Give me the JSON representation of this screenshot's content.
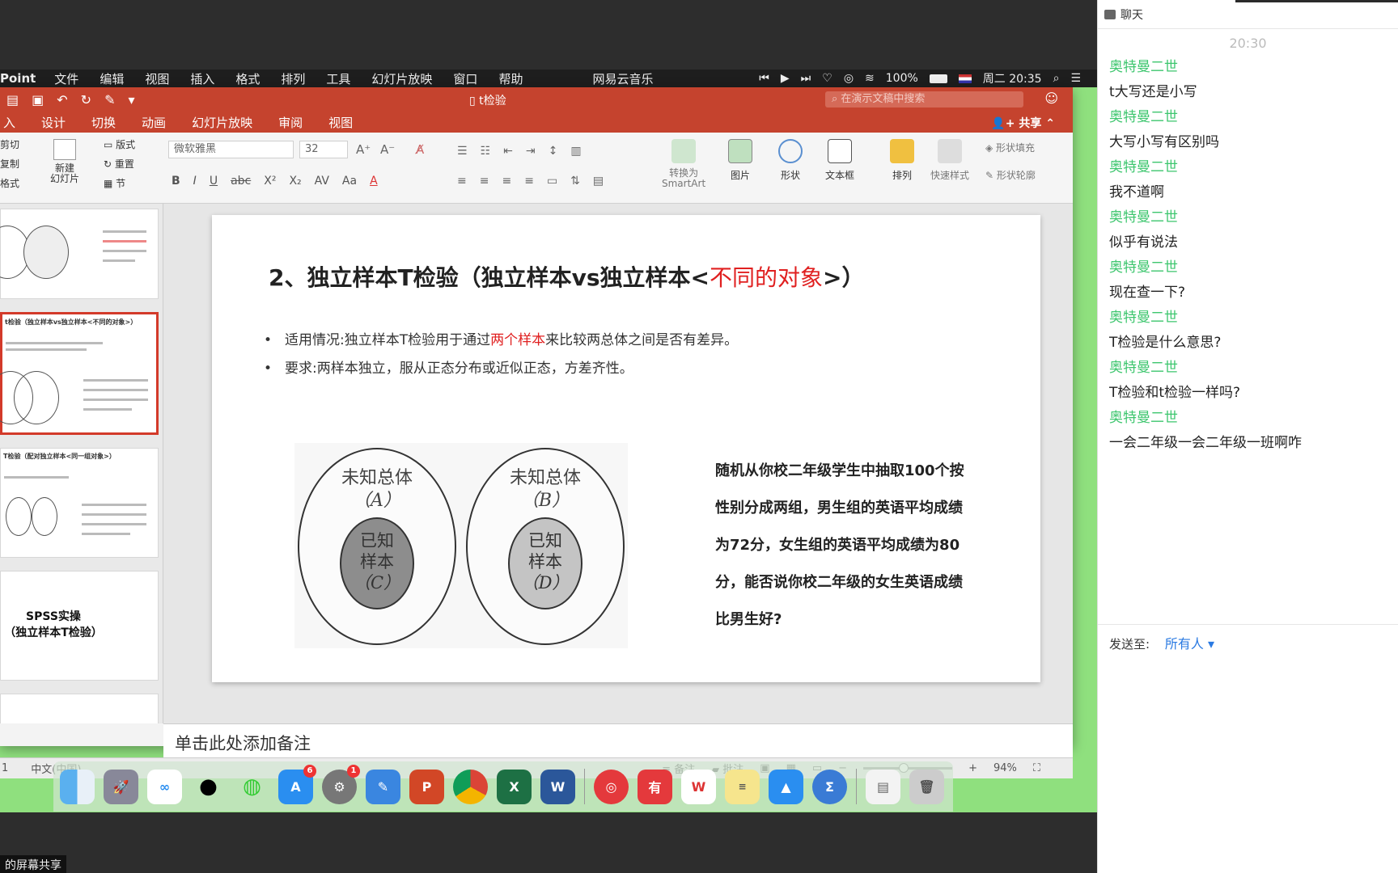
{
  "mac_menubar": {
    "app_name": "Point",
    "menus": [
      "文件",
      "编辑",
      "视图",
      "插入",
      "格式",
      "排列",
      "工具",
      "幻灯片放映",
      "窗口",
      "帮助"
    ],
    "netease": "网易云音乐",
    "battery": "100%",
    "clock": "周二 20:35"
  },
  "titlebar": {
    "doc_title": "t检验",
    "search_placeholder": "在演示文稿中搜索"
  },
  "ribbon_tabs": {
    "tabs": [
      "入",
      "设计",
      "切换",
      "动画",
      "幻灯片放映",
      "审阅",
      "视图"
    ],
    "share": "共享"
  },
  "ribbon": {
    "cut": "剪切",
    "copy": "复制",
    "format": "格式",
    "new_slide": "新建\n幻灯片",
    "layout": "版式",
    "reset": "重置",
    "section": "节",
    "font": "微软雅黑",
    "size": "32",
    "convert": "转换为\nSmartArt",
    "picture": "图片",
    "shape": "形状",
    "textbox": "文本框",
    "arrange": "排列",
    "quick_style": "快速样式",
    "shape_fill": "形状填充",
    "shape_outline": "形状轮廓"
  },
  "thumbnails": {
    "t2_title": "t检验（独立样本vs独立样本<不同的对象>）",
    "t3_title": "T检验（配对独立样本<同一组对象>）",
    "t4_line1": "SPSS实操",
    "t4_line2": "（独立样本T检验）"
  },
  "slide": {
    "title_main": "2、独立样本T检验（独立样本vs独立样本<",
    "title_red": "不同的对象",
    "title_end": ">）",
    "bullet1_pre": "适用情况:独立样本T检验用于通过",
    "bullet1_red": "两个样本",
    "bullet1_post": "来比较两总体之间是否有差异。",
    "bullet2": "要求:两样本独立，服从正态分布或近似正态，方差齐性。",
    "venn_a_top1": "未知总体",
    "venn_a_top2": "（A）",
    "venn_a_in1": "已知",
    "venn_a_in2": "样本",
    "venn_a_in3": "（C）",
    "venn_b_top1": "未知总体",
    "venn_b_top2": "（B）",
    "venn_b_in1": "已知",
    "venn_b_in2": "样本",
    "venn_b_in3": "（D）",
    "example": "随机从你校二年级学生中抽取100个按性别分成两组，男生组的英语平均成绩为72分，女生组的英语平均成绩为80分，能否说你校二年级的女生英语成绩比男生好?"
  },
  "notes": "单击此处添加备注",
  "status": {
    "slide_num": "1",
    "lang": "中文(中国)",
    "notes_btn": "备注",
    "comments_btn": "批注",
    "zoom": "94%",
    "zoom_level": 0.45
  },
  "dock": {
    "appstore_badge": "6",
    "settings_badge": "1"
  },
  "chat": {
    "header": "聊天",
    "time": "20:30",
    "messages": [
      {
        "sender": "奥特曼二世",
        "text": "t大写还是小写"
      },
      {
        "sender": "奥特曼二世",
        "text": "大写小写有区别吗"
      },
      {
        "sender": "奥特曼二世",
        "text": "我不道啊"
      },
      {
        "sender": "奥特曼二世",
        "text": "似乎有说法"
      },
      {
        "sender": "奥特曼二世",
        "text": "现在查一下?"
      },
      {
        "sender": "奥特曼二世",
        "text": "T检验是什么意思?"
      },
      {
        "sender": "奥特曼二世",
        "text": "T检验和t检验一样吗?"
      },
      {
        "sender": "奥特曼二世",
        "text": "一会二年级一会二年级一班啊咋"
      }
    ],
    "send_to_label": "发送至:",
    "send_to_target": "所有人"
  },
  "share_label": "的屏幕共享",
  "colors": {
    "ppt_red": "#c5432e",
    "accent_red": "#e02020",
    "chat_green": "#3dc66e",
    "link_blue": "#2a7ae2"
  }
}
